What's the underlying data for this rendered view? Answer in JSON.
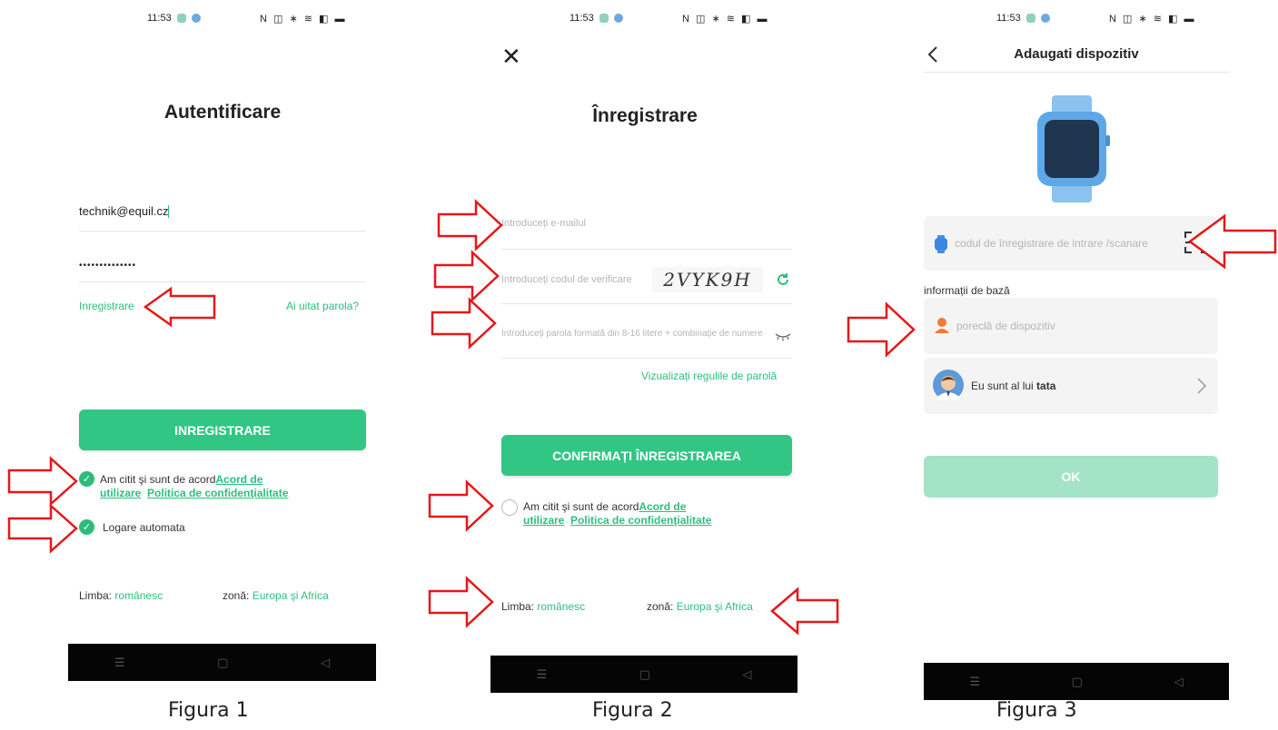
{
  "status": {
    "time": "11:53",
    "icons": "N ◫ ∗ ≋ ◧ ▬"
  },
  "screen1": {
    "title": "Autentificare",
    "email_value": "technik@equil.cz",
    "password_value": "••••••••••••••",
    "register_link": "Inregistrare",
    "forgot_link": "Ai uitat parola?",
    "register_button": "INREGISTRARE",
    "agree_text": "Am citit şi sunt de acord",
    "agree_link1_a": "Acord de",
    "agree_link1_b": "utilizare",
    "agree_link2": "Politica de confidenţialitate",
    "auto_login": "Logare automata",
    "language_label": "Limba:",
    "language_value": "românesc",
    "zone_label": "zonă:",
    "zone_value": "Europa şi Africa",
    "caption": "Figura 1"
  },
  "screen2": {
    "close_icon": "✕",
    "title": "Înregistrare",
    "email_placeholder": "Introduceți e-mailul",
    "code_placeholder": "Introduceți codul de verificare",
    "captcha": "2VYK9H",
    "password_placeholder": "Introduceți parola formată din 8-16 litere + combinație de numere",
    "password_rules": "Vizualizați regulile de parolă",
    "confirm_button": "CONFIRMAȚI ÎNREGISTRAREA",
    "agree_text": "Am citit şi sunt de acord",
    "agree_link1_a": "Acord de",
    "agree_link1_b": "utilizare",
    "agree_link2": "Politica de confidenţialitate",
    "language_label": "Limba:",
    "language_value": "românesc",
    "zone_label": "zonă:",
    "zone_value": "Europa şi Africa",
    "caption": "Figura 2"
  },
  "screen3": {
    "title": "Adaugati dispozitiv",
    "code_placeholder": "codul de înregistrare de intrare /scanare",
    "section_label": "informații de bază",
    "nickname_placeholder": "poreclă de dispozitiv",
    "relation_prefix": "Eu sunt al lui ",
    "relation_value": "tata",
    "ok_button": "OK",
    "caption": "Figura 3"
  },
  "navbar": {
    "menu": "☰",
    "home": "▢",
    "back": "◁"
  },
  "colors": {
    "accent": "#31c684",
    "arrow": "#e41818",
    "device_blue": "#5fa8e8",
    "ok_disabled": "#a4e4c6"
  }
}
